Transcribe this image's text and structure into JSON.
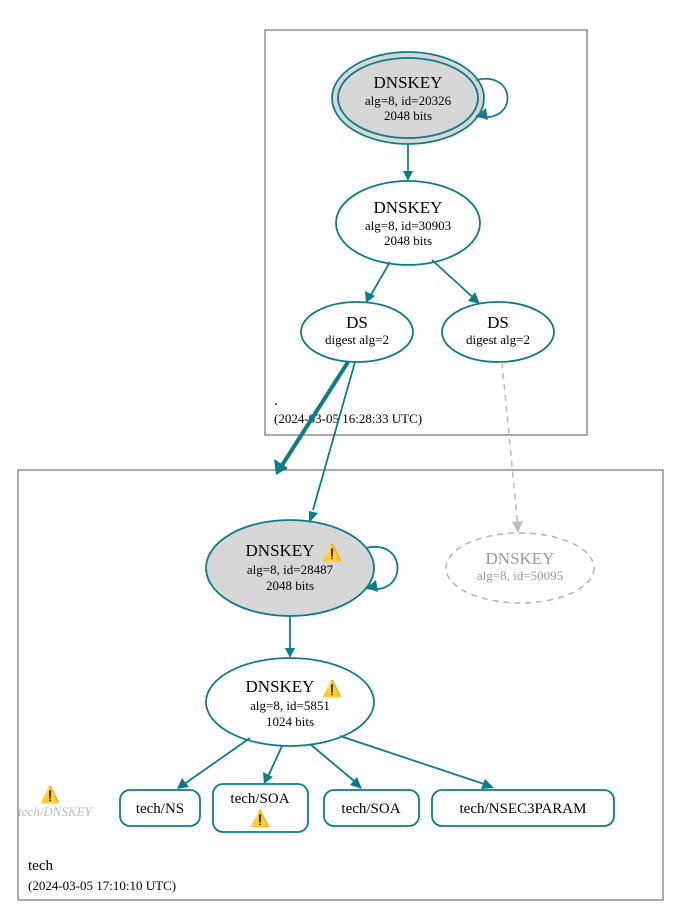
{
  "zones": {
    "root": {
      "label": ".",
      "timestamp": "(2024-03-05 16:28:33 UTC)"
    },
    "tech": {
      "label": "tech",
      "timestamp": "(2024-03-05 17:10:10 UTC)"
    }
  },
  "nodes": {
    "root_ksk": {
      "title": "DNSKEY",
      "line1": "alg=8, id=20326",
      "line2": "2048 bits"
    },
    "root_zsk": {
      "title": "DNSKEY",
      "line1": "alg=8, id=30903",
      "line2": "2048 bits"
    },
    "ds_left": {
      "title": "DS",
      "line1": "digest alg=2"
    },
    "ds_right": {
      "title": "DS",
      "line1": "digest alg=2"
    },
    "tech_ksk": {
      "title": "DNSKEY",
      "line1": "alg=8, id=28487",
      "line2": "2048 bits"
    },
    "tech_zsk": {
      "title": "DNSKEY",
      "line1": "alg=8, id=5851",
      "line2": "1024 bits"
    },
    "tech_missing_key": {
      "title": "DNSKEY",
      "line1": "alg=8, id=50095"
    },
    "faded_dnskey": {
      "label": "tech/DNSKEY"
    },
    "rr_ns": {
      "label": "tech/NS"
    },
    "rr_soa_warn": {
      "label": "tech/SOA"
    },
    "rr_soa": {
      "label": "tech/SOA"
    },
    "rr_nsec3param": {
      "label": "tech/NSEC3PARAM"
    }
  },
  "icons": {
    "warning": "⚠️"
  }
}
